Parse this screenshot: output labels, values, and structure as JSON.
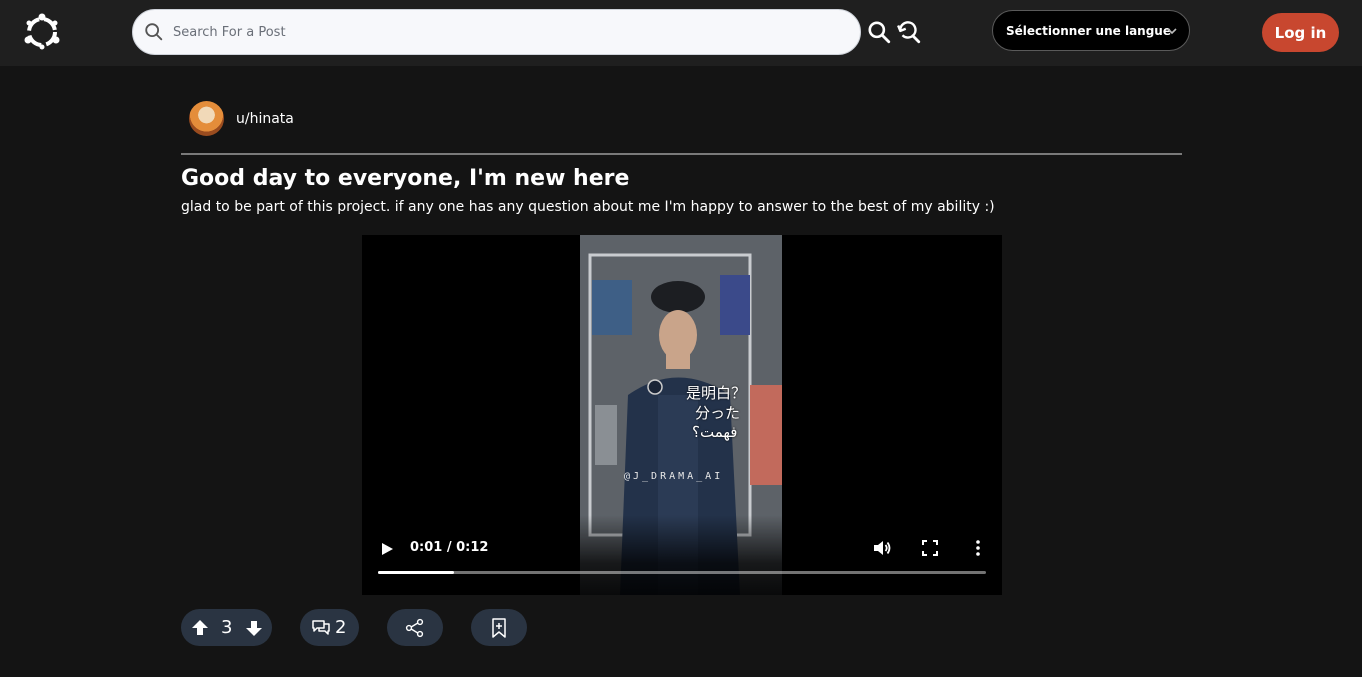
{
  "header": {
    "logo_icon": "network-logo-icon",
    "search_placeholder": "Search For a Post",
    "search_icon": "search-icon",
    "reset_icon": "refresh-search-icon",
    "language_label": "Sélectionner une langue",
    "login_label": "Log in",
    "colors": {
      "topbar": "#1f1f1f",
      "login_bg": "#c8472f"
    }
  },
  "post": {
    "author": "u/hinata",
    "title": "Good day to everyone, I'm new here",
    "body": "glad to be part of this project. if any one has any question about me I'm happy to answer to the best of my ability :)",
    "video": {
      "caption_lines": [
        "是明白？",
        "分った",
        "فهمت؟"
      ],
      "watermark": "@J_DRAMA_AI",
      "time_display": "0:01 / 0:12",
      "progress_fraction": 0.125
    },
    "actions": {
      "votes": "3",
      "comments": "2",
      "upvote_icon": "upvote-arrow-icon",
      "downvote_icon": "downvote-arrow-icon",
      "comment_icon": "comments-icon",
      "share_icon": "share-icon",
      "bookmark_icon": "bookmark-add-icon"
    }
  }
}
